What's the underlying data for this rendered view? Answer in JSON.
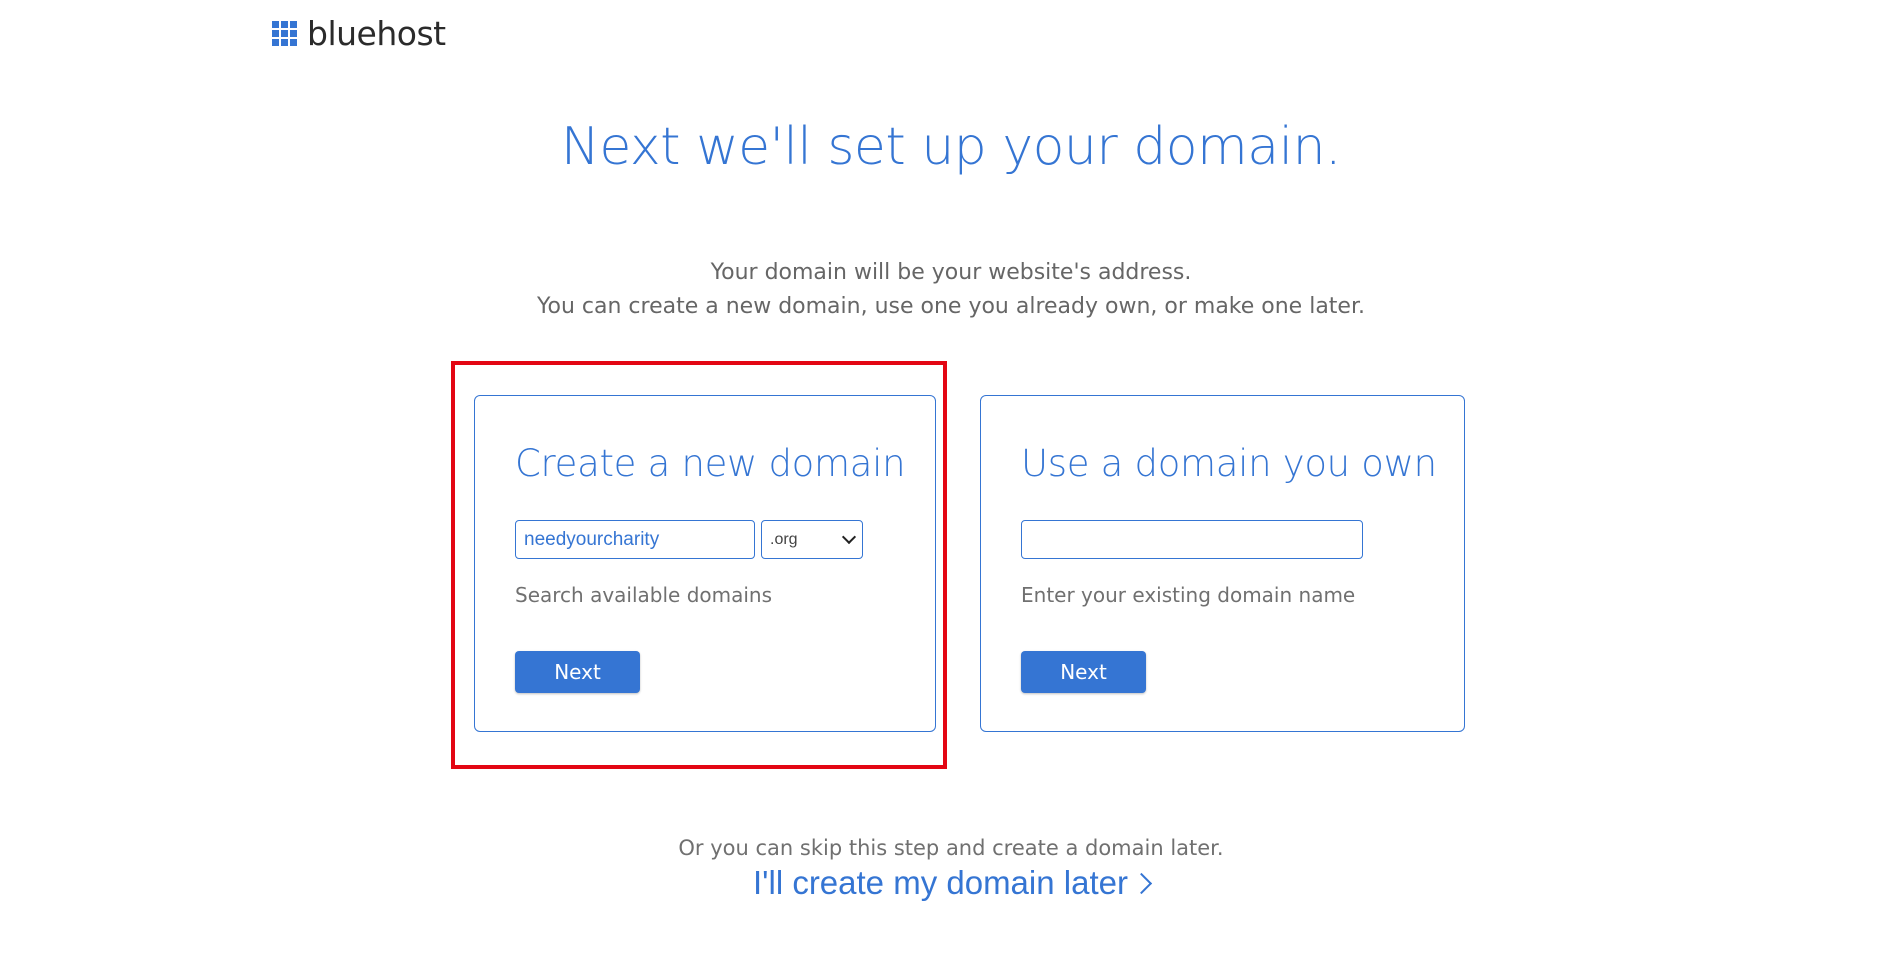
{
  "brand": {
    "name": "bluehost",
    "accent_color": "#3575d3",
    "highlight_color": "#e30613"
  },
  "headline": "Next we'll set up your domain.",
  "intro": {
    "line1": "Your domain will be your website's address.",
    "line2": "You can create a new domain, use one you already own, or make one later."
  },
  "new_domain": {
    "title": "Create a new domain",
    "input_value": "needyourcharity",
    "tld_selected": ".org",
    "helper": "Search available domains",
    "next_label": "Next"
  },
  "own_domain": {
    "title": "Use a domain you own",
    "input_value": "",
    "helper": "Enter your existing domain name",
    "next_label": "Next"
  },
  "skip": {
    "text": "Or you can skip this step and create a domain later.",
    "link_label": "I'll create my domain later"
  }
}
